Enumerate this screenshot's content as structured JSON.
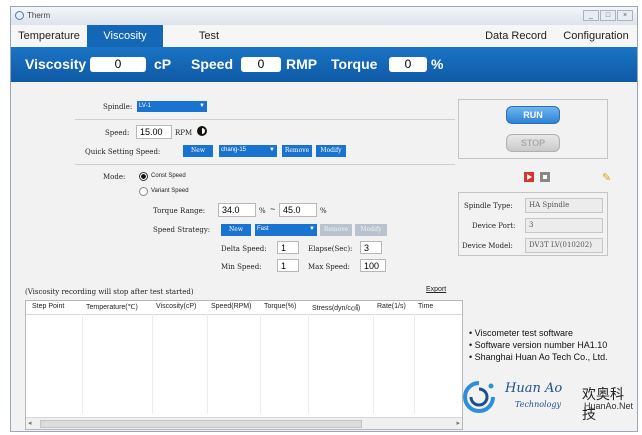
{
  "window": {
    "title": "Therm",
    "controls": [
      "_",
      "□",
      "×"
    ]
  },
  "tabs": [
    {
      "label": "Temperature",
      "active": false
    },
    {
      "label": "Viscosity",
      "active": true
    },
    {
      "label": "Test",
      "active": false
    },
    {
      "label": "Data Record",
      "active": false
    },
    {
      "label": "Configuration",
      "active": false
    }
  ],
  "readout": {
    "viscosity_label": "Viscosity",
    "viscosity_value": "0",
    "viscosity_unit": "cP",
    "speed_label": "Speed",
    "speed_value": "0",
    "speed_unit": "RMP",
    "torque_label": "Torque",
    "torque_value": "0",
    "torque_unit": "%"
  },
  "form": {
    "spindle_label": "Spindle:",
    "spindle_value": "LV-1",
    "speed_label": "Speed:",
    "speed_value": "15.00",
    "speed_unit": "RPM",
    "quick_label": "Quick Setting Speed:",
    "quick_new": "New",
    "quick_select": "chang-15",
    "quick_remove": "Remove",
    "quick_modify": "Modify",
    "mode_label": "Mode:",
    "mode_const": "Const Speed",
    "mode_variant": "Variant Speed",
    "torque_range_label": "Torque Range:",
    "torque_min": "34.0",
    "torque_min_unit": "%",
    "torque_sep": "~",
    "torque_max": "45.0",
    "torque_max_unit": "%",
    "strategy_label": "Speed Strategy:",
    "strategy_new": "New",
    "strategy_select": "Fast",
    "strategy_remove": "Remove",
    "strategy_modify": "Modify",
    "delta_label": "Delta Speed:",
    "delta_value": "1",
    "elapse_label": "Elapse(Sec):",
    "elapse_value": "3",
    "min_label": "Min Speed:",
    "min_value": "1",
    "max_label": "Max Speed:",
    "max_value": "100"
  },
  "controls": {
    "run": "RUN",
    "stop": "STOP"
  },
  "device": {
    "type_label": "Spindle Type:",
    "type_value": "HA Spindle",
    "port_label": "Device Port:",
    "port_value": "3",
    "model_label": "Device Model:",
    "model_value": "DV3T LV(010202)"
  },
  "log": {
    "note": "(Viscosity recording will stop after test started)",
    "export": "Export",
    "columns": [
      "Step Point",
      "Temperature(℃)",
      "Viscosity(cP)",
      "Speed(RPM)",
      "Torque(%)",
      "Stress(dyn/c㎠)",
      "Rate(1/s)",
      "Time"
    ]
  },
  "about": {
    "line1": "Viscometer test software",
    "line2": "Software version number HA1.10",
    "line3": "Shanghai Huan Ao Tech Co., Ltd.",
    "logo_script1": "Huan Ao",
    "logo_script2": "Technology",
    "logo_cn": "欢奥科技",
    "logo_en": "HuanAo.Net"
  },
  "colors": {
    "accent": "#1466b6",
    "button_blue": "#1a73d0",
    "red_icon": "#d9342b"
  }
}
